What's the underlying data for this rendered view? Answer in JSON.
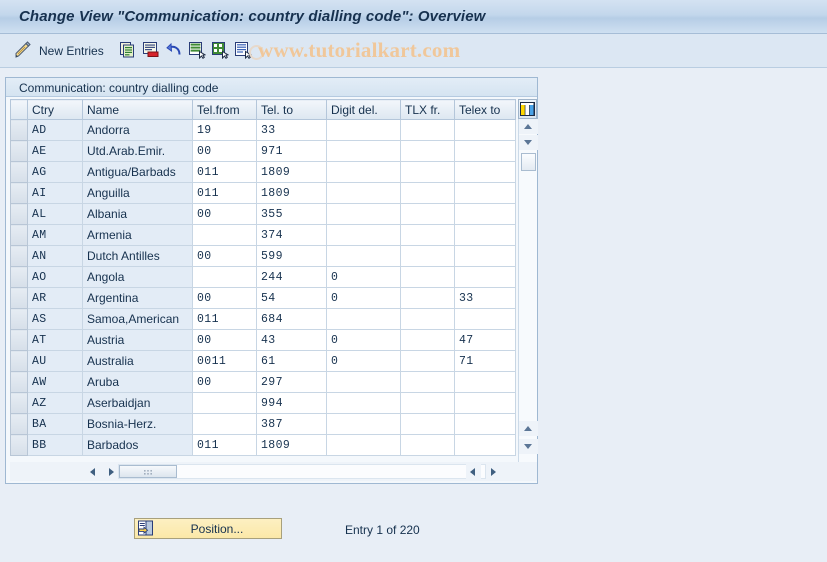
{
  "window": {
    "title": "Change View \"Communication: country dialling code\": Overview"
  },
  "toolbar": {
    "pencil_icon": "pencil-display-change-icon",
    "new_entries_label": "New Entries",
    "buttons": [
      {
        "icon": "copy-as-icon",
        "name": "copy-as-button"
      },
      {
        "icon": "delete-row-icon",
        "name": "delete-button"
      },
      {
        "icon": "undo-icon",
        "name": "undo-button"
      },
      {
        "icon": "select-all-icon",
        "name": "select-all-button"
      },
      {
        "icon": "deselect-all-icon",
        "name": "deselect-all-button"
      },
      {
        "icon": "variant-icon",
        "name": "variant-button"
      }
    ],
    "watermark": "www.tutorialkart.com"
  },
  "panel": {
    "caption": "Communication: country dialling code"
  },
  "grid": {
    "columns": [
      {
        "key": "sel",
        "label": ""
      },
      {
        "key": "ctry",
        "label": "Ctry"
      },
      {
        "key": "name",
        "label": "Name"
      },
      {
        "key": "telf",
        "label": "Tel.from"
      },
      {
        "key": "telt",
        "label": "Tel. to"
      },
      {
        "key": "digit",
        "label": "Digit del."
      },
      {
        "key": "tlx",
        "label": "TLX fr."
      },
      {
        "key": "telex",
        "label": "Telex to"
      }
    ],
    "config_icon": "grid-columns-config-icon",
    "rows": [
      {
        "ctry": "AD",
        "name": "Andorra",
        "telf": "19",
        "telt": "33",
        "digit": "",
        "tlx": "",
        "telex": ""
      },
      {
        "ctry": "AE",
        "name": "Utd.Arab.Emir.",
        "telf": "00",
        "telt": "971",
        "digit": "",
        "tlx": "",
        "telex": ""
      },
      {
        "ctry": "AG",
        "name": "Antigua/Barbads",
        "telf": "011",
        "telt": "1809",
        "digit": "",
        "tlx": "",
        "telex": ""
      },
      {
        "ctry": "AI",
        "name": "Anguilla",
        "telf": "011",
        "telt": "1809",
        "digit": "",
        "tlx": "",
        "telex": ""
      },
      {
        "ctry": "AL",
        "name": "Albania",
        "telf": "00",
        "telt": "355",
        "digit": "",
        "tlx": "",
        "telex": ""
      },
      {
        "ctry": "AM",
        "name": "Armenia",
        "telf": "",
        "telt": "374",
        "digit": "",
        "tlx": "",
        "telex": ""
      },
      {
        "ctry": "AN",
        "name": "Dutch Antilles",
        "telf": "00",
        "telt": "599",
        "digit": "",
        "tlx": "",
        "telex": ""
      },
      {
        "ctry": "AO",
        "name": "Angola",
        "telf": "",
        "telt": "244",
        "digit": "0",
        "tlx": "",
        "telex": ""
      },
      {
        "ctry": "AR",
        "name": "Argentina",
        "telf": "00",
        "telt": "54",
        "digit": "0",
        "tlx": "",
        "telex": "33"
      },
      {
        "ctry": "AS",
        "name": "Samoa,American",
        "telf": "011",
        "telt": "684",
        "digit": "",
        "tlx": "",
        "telex": ""
      },
      {
        "ctry": "AT",
        "name": "Austria",
        "telf": "00",
        "telt": "43",
        "digit": "0",
        "tlx": "",
        "telex": "47"
      },
      {
        "ctry": "AU",
        "name": "Australia",
        "telf": "0011",
        "telt": "61",
        "digit": "0",
        "tlx": "",
        "telex": "71"
      },
      {
        "ctry": "AW",
        "name": "Aruba",
        "telf": "00",
        "telt": "297",
        "digit": "",
        "tlx": "",
        "telex": ""
      },
      {
        "ctry": "AZ",
        "name": "Aserbaidjan",
        "telf": "",
        "telt": "994",
        "digit": "",
        "tlx": "",
        "telex": ""
      },
      {
        "ctry": "BA",
        "name": "Bosnia-Herz.",
        "telf": "",
        "telt": "387",
        "digit": "",
        "tlx": "",
        "telex": ""
      },
      {
        "ctry": "BB",
        "name": "Barbados",
        "telf": "011",
        "telt": "1809",
        "digit": "",
        "tlx": "",
        "telex": ""
      }
    ]
  },
  "footer": {
    "position_button_label": "Position...",
    "position_button_icon": "position-find-icon",
    "entry_status": "Entry 1 of 220"
  },
  "colors": {
    "title_bar": "#c3d7ec",
    "toolbar": "#dce7f3",
    "background": "#e8eef6",
    "watermark": "#f0c79a",
    "button_yellow": "#fbe8a8",
    "row_label": "#e3ecf6"
  }
}
